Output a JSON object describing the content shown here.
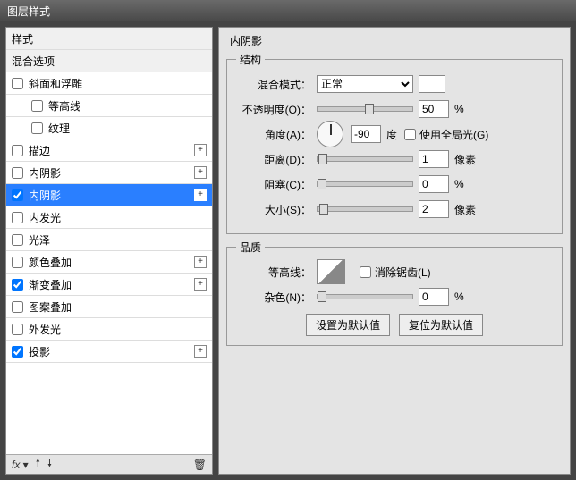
{
  "window": {
    "title": "图层样式"
  },
  "left": {
    "header_styles": "样式",
    "header_blend": "混合选项",
    "items": [
      {
        "label": "斜面和浮雕",
        "checked": false,
        "plus": false
      },
      {
        "label": "等高线",
        "checked": false,
        "indent": true
      },
      {
        "label": "纹理",
        "checked": false,
        "indent": true
      },
      {
        "label": "描边",
        "checked": false,
        "plus": true
      },
      {
        "label": "内阴影",
        "checked": false,
        "plus": true
      },
      {
        "label": "内阴影",
        "checked": true,
        "plus": true,
        "selected": true
      },
      {
        "label": "内发光",
        "checked": false
      },
      {
        "label": "光泽",
        "checked": false
      },
      {
        "label": "颜色叠加",
        "checked": false,
        "plus": true
      },
      {
        "label": "渐变叠加",
        "checked": true,
        "plus": true
      },
      {
        "label": "图案叠加",
        "checked": false
      },
      {
        "label": "外发光",
        "checked": false
      },
      {
        "label": "投影",
        "checked": true,
        "plus": true
      }
    ],
    "fx_label": "fx"
  },
  "right": {
    "panel_title": "内阴影",
    "structure_legend": "结构",
    "blend_mode_label": "混合模式：",
    "blend_mode_value": "正常",
    "opacity_label": "不透明度(O)：",
    "opacity_value": "50",
    "opacity_unit": "%",
    "angle_label": "角度(A)：",
    "angle_value": "-90",
    "angle_unit": "度",
    "global_light_label": "使用全局光(G)",
    "distance_label": "距离(D)：",
    "distance_value": "1",
    "distance_unit": "像素",
    "choke_label": "阻塞(C)：",
    "choke_value": "0",
    "choke_unit": "%",
    "size_label": "大小(S)：",
    "size_value": "2",
    "size_unit": "像素",
    "quality_legend": "品质",
    "contour_label": "等高线：",
    "antialias_label": "消除锯齿(L)",
    "noise_label": "杂色(N)：",
    "noise_value": "0",
    "noise_unit": "%",
    "btn_default": "设置为默认值",
    "btn_reset": "复位为默认值"
  }
}
